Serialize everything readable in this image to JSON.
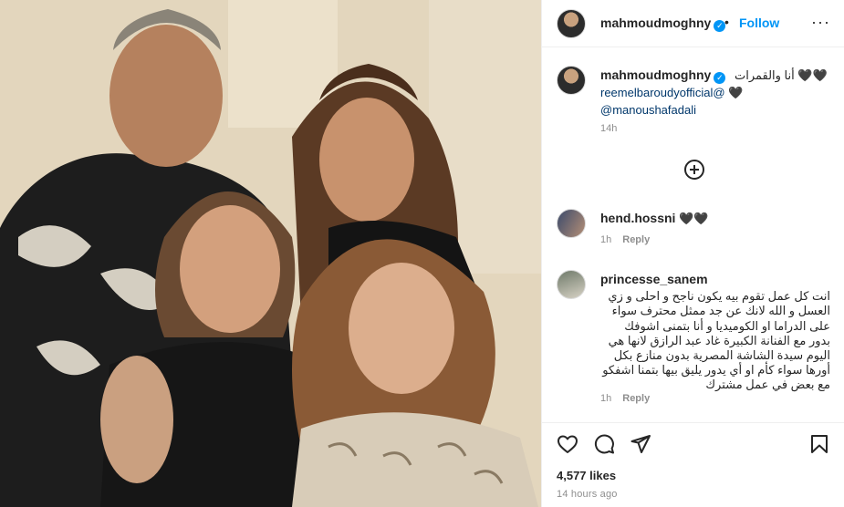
{
  "post": {
    "author": "mahmoudmoghny",
    "verified_mark": "✓",
    "dot": "•",
    "follow_label": "Follow",
    "more_label": "···",
    "caption": {
      "text": "أنا والقمرات 🖤🖤",
      "mention_1": "reemelbaroudyofficial@",
      "heart_1": "🖤",
      "mention_2": "@manoushafadali",
      "time": "14h"
    },
    "load_more_icon": "plus-circle-icon",
    "likes": "4,577 likes",
    "timestamp": "14 hours ago"
  },
  "comments": [
    {
      "username": "hend.hossni",
      "text": "🖤🖤",
      "time": "1h",
      "reply_label": "Reply"
    },
    {
      "username": "princesse_sanem",
      "text": "انت كل عمل تقوم بيه يكون ناجح و احلى و زي العسل و الله لانك عن جد ممثل محترف سواء على الدراما او الكوميديا و أنا بتمنى اشوفك بدور مع الفنانة الكبيرة غاد عبد الرازق لانها هي اليوم سيدة الشاشة المصرية بدون منازع بكل أورها سواء كأم او أي يدور يليق بيها بتمنا اشفكو مع بعض في عمل مشترك",
      "time": "1h",
      "reply_label": "Reply"
    }
  ],
  "icons": {
    "like": "heart-icon",
    "comment": "comment-icon",
    "share": "paper-plane-icon",
    "save": "bookmark-icon"
  },
  "colors": {
    "accent": "#0095f6",
    "mention": "#00376b",
    "muted": "#8e8e8e"
  }
}
